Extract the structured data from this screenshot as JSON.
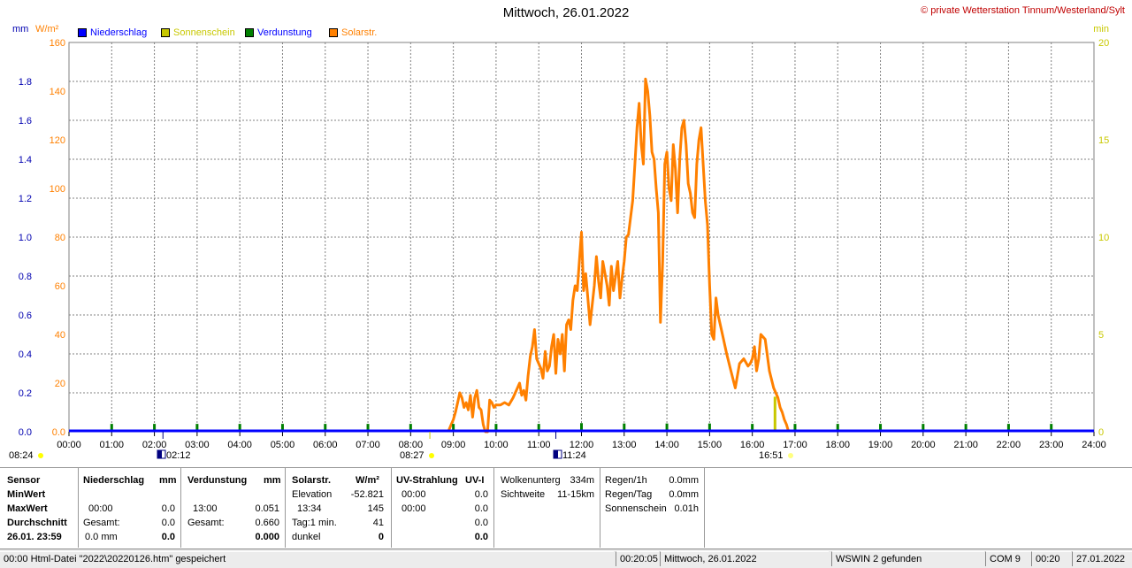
{
  "title": "Mittwoch, 26.01.2022",
  "copyright": "© private Wetterstation Tinnum/Westerland/Sylt",
  "units": {
    "left_mm": "mm",
    "left_wm2": "W/m²",
    "right_min": "min"
  },
  "legend": [
    {
      "label": "Niederschlag",
      "color": "#0000ff",
      "text_color": "#0000ff"
    },
    {
      "label": "Sonnenschein",
      "color": "#c8c800",
      "text_color": "#c8c800"
    },
    {
      "label": "Verdunstung",
      "color": "#008000",
      "text_color": "#0000ff"
    },
    {
      "label": "Solarstr.",
      "color": "#ff8000",
      "text_color": "#ff8000"
    }
  ],
  "chart_data": {
    "type": "line",
    "title": "Mittwoch, 26.01.2022",
    "x_range_hours": [
      0,
      24
    ],
    "x_tick_labels": [
      "00:00",
      "01:00",
      "02:00",
      "03:00",
      "04:00",
      "05:00",
      "06:00",
      "07:00",
      "08:00",
      "09:00",
      "10:00",
      "11:00",
      "12:00",
      "13:00",
      "14:00",
      "15:00",
      "16:00",
      "17:00",
      "18:00",
      "19:00",
      "20:00",
      "21:00",
      "22:00",
      "23:00",
      "24:00"
    ],
    "y_mm": {
      "range": [
        0,
        2.0
      ],
      "ticks": [
        "0.0",
        "0.2",
        "0.4",
        "0.6",
        "0.8",
        "1.0",
        "1.2",
        "1.4",
        "1.6",
        "1.8"
      ]
    },
    "y_wm2": {
      "range": [
        0,
        160
      ],
      "ticks": [
        "0.0",
        "20",
        "40",
        "60",
        "80",
        "100",
        "120",
        "140",
        "160"
      ]
    },
    "y_min": {
      "range": [
        0,
        20
      ],
      "ticks": [
        "0",
        "5",
        "10",
        "15",
        "20"
      ]
    },
    "grid": true,
    "legend_position": "top-left",
    "series": [
      {
        "name": "Solarstr.",
        "color": "#ff8000",
        "axis": "W/m²",
        "x": [
          8.88,
          8.95,
          9.0,
          9.05,
          9.1,
          9.15,
          9.2,
          9.25,
          9.3,
          9.35,
          9.4,
          9.45,
          9.5,
          9.55,
          9.6,
          9.65,
          9.7,
          9.75,
          9.8,
          9.85,
          9.9,
          9.95,
          10.0,
          10.1,
          10.2,
          10.3,
          10.4,
          10.5,
          10.55,
          10.6,
          10.65,
          10.7,
          10.75,
          10.8,
          10.85,
          10.9,
          10.95,
          11.0,
          11.05,
          11.1,
          11.15,
          11.2,
          11.25,
          11.3,
          11.35,
          11.4,
          11.45,
          11.5,
          11.55,
          11.6,
          11.65,
          11.7,
          11.75,
          11.8,
          11.85,
          11.9,
          11.95,
          12.0,
          12.05,
          12.1,
          12.15,
          12.2,
          12.25,
          12.3,
          12.35,
          12.4,
          12.45,
          12.5,
          12.55,
          12.6,
          12.65,
          12.7,
          12.75,
          12.8,
          12.85,
          12.9,
          12.95,
          13.0,
          13.05,
          13.1,
          13.15,
          13.2,
          13.25,
          13.3,
          13.35,
          13.4,
          13.45,
          13.5,
          13.55,
          13.6,
          13.65,
          13.7,
          13.75,
          13.8,
          13.85,
          13.9,
          13.95,
          14.0,
          14.05,
          14.1,
          14.15,
          14.2,
          14.25,
          14.3,
          14.35,
          14.4,
          14.45,
          14.5,
          14.55,
          14.6,
          14.65,
          14.7,
          14.75,
          14.8,
          14.85,
          14.9,
          14.95,
          15.0,
          15.05,
          15.1,
          15.15,
          15.2,
          15.3,
          15.4,
          15.5,
          15.6,
          15.7,
          15.8,
          15.9,
          15.95,
          16.0,
          16.05,
          16.1,
          16.15,
          16.2,
          16.3,
          16.4,
          16.5,
          16.6,
          16.65,
          16.7,
          16.75,
          16.8,
          16.85
        ],
        "y": [
          0,
          3,
          5,
          8,
          12,
          16,
          14,
          10,
          12,
          9,
          15,
          6,
          14,
          17,
          10,
          9,
          3,
          0,
          0,
          13,
          12,
          10,
          11,
          11,
          12,
          11,
          14,
          18,
          20,
          15,
          17,
          13,
          23,
          31,
          35,
          42,
          30,
          28,
          26,
          22,
          33,
          25,
          27,
          35,
          40,
          24,
          38,
          32,
          40,
          25,
          44,
          46,
          42,
          54,
          60,
          58,
          70,
          82,
          58,
          65,
          55,
          44,
          52,
          60,
          72,
          62,
          55,
          70,
          65,
          60,
          52,
          68,
          58,
          64,
          70,
          55,
          63,
          70,
          80,
          81,
          88,
          95,
          110,
          125,
          135,
          118,
          110,
          145,
          140,
          130,
          115,
          112,
          100,
          90,
          45,
          70,
          110,
          115,
          100,
          95,
          118,
          108,
          90,
          112,
          125,
          128,
          118,
          102,
          98,
          90,
          88,
          110,
          120,
          125,
          110,
          95,
          85,
          60,
          40,
          38,
          55,
          48,
          40,
          32,
          25,
          18,
          28,
          30,
          27,
          28,
          30,
          35,
          25,
          30,
          40,
          38,
          25,
          18,
          14,
          10,
          8,
          5,
          3,
          0
        ]
      },
      {
        "name": "Sonnenschein",
        "color": "#c8c800",
        "axis": "min",
        "x": [
          5.2,
          7.2,
          16.5,
          16.6
        ],
        "y": [
          0.08,
          0.08,
          1.0,
          1.8
        ]
      },
      {
        "name": "Verdunstung",
        "color": "#008000",
        "axis": "mm",
        "x": [
          1,
          2,
          3,
          4,
          5,
          6,
          7,
          8,
          9,
          10,
          11,
          12,
          13,
          14,
          15,
          16,
          17,
          18,
          19,
          20,
          21,
          22,
          23
        ],
        "y": [
          0.004,
          0.004,
          0.004,
          0.004,
          0.004,
          0.004,
          0.004,
          0.004,
          0.004,
          0.004,
          0.004,
          0.008,
          0.006,
          0.006,
          0.006,
          0.004,
          0.004,
          0.004,
          0.004,
          0.004,
          0.004,
          0.004,
          0.004
        ]
      },
      {
        "name": "Niederschlag",
        "color": "#0000ff",
        "axis": "mm",
        "x": [
          0,
          24
        ],
        "y": [
          0,
          0
        ]
      }
    ],
    "time_markers": [
      {
        "label": "08:24",
        "type": "sunrise"
      },
      {
        "label": "02:12",
        "type": "moon"
      },
      {
        "label": "08:27",
        "type": "sunrise"
      },
      {
        "label": "11:24",
        "type": "moon"
      },
      {
        "label": "16:51",
        "type": "sunset"
      }
    ]
  },
  "stats": {
    "labels": {
      "sensor": "Sensor",
      "min": "MinWert",
      "max": "MaxWert",
      "avg": "Durchschnitt",
      "date": "26.01. 23:59"
    },
    "niederschlag": {
      "title": "Niederschlag",
      "unit": "mm",
      "max_time": "00:00",
      "max_val": "0.0",
      "gesamt_label": "Gesamt:",
      "gesamt_val": "0.0",
      "avg_left": "0.0 mm",
      "avg_right": "0.0"
    },
    "verdunstung": {
      "title": "Verdunstung",
      "unit": "mm",
      "max_time": "13:00",
      "max_val": "0.051",
      "gesamt_label": "Gesamt:",
      "gesamt_val": "0.660",
      "avg_right": "0.000"
    },
    "solar": {
      "title": "Solarstr.",
      "unit": "W/m²",
      "elev_label": "Elevation",
      "elev_val": "-52.821",
      "max_time": "13:34",
      "max_val": "145",
      "tag_label": "Tag:1 min.",
      "tag_val": "41",
      "dunkel_label": "dunkel",
      "dunkel_val": "0"
    },
    "uv": {
      "title": "UV-Strahlung",
      "unit": "UV-I",
      "min_time": "00:00",
      "min_val": "0.0",
      "max_time": "00:00",
      "max_val": "0.0",
      "mid_val": "0.0",
      "avg_val": "0.0"
    },
    "wolken": {
      "label1": "Wolkenunterg",
      "val1": "334m",
      "label2": "Sichtweite",
      "val2": "11-15km"
    },
    "regen": {
      "label1": "Regen/1h",
      "val1": "0.0mm",
      "label2": "Regen/Tag",
      "val2": "0.0mm",
      "label3": "Sonnenschein",
      "val3": "0.01h"
    }
  },
  "statusbar": {
    "s1": "00:00  Html-Datei  \"2022\\20220126.htm\"  gespeichert",
    "s2": "00:20:05",
    "s3": "Mittwoch, 26.01.2022",
    "s4": "WSWIN 2 gefunden",
    "s5": "COM 9",
    "s6": "00:20",
    "s7": "27.01.2022"
  }
}
